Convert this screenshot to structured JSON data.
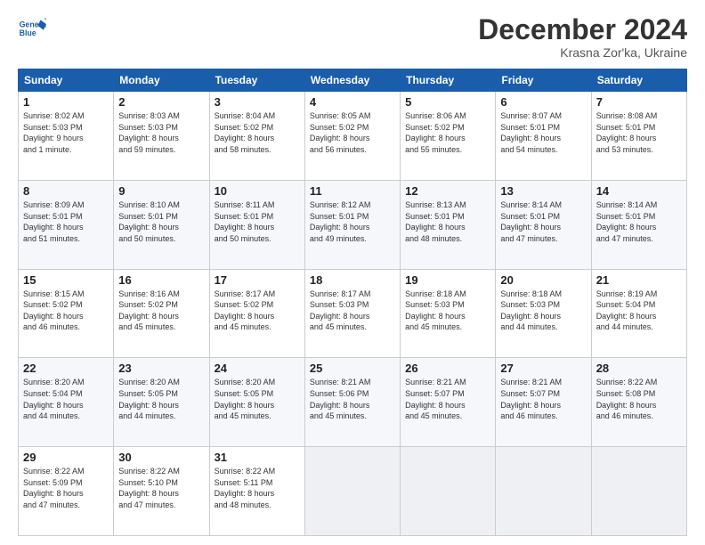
{
  "logo": {
    "line1": "General",
    "line2": "Blue"
  },
  "header": {
    "month_title": "December 2024",
    "subtitle": "Krasna Zor'ka, Ukraine"
  },
  "weekdays": [
    "Sunday",
    "Monday",
    "Tuesday",
    "Wednesday",
    "Thursday",
    "Friday",
    "Saturday"
  ],
  "weeks": [
    [
      {
        "day": "1",
        "info": "Sunrise: 8:02 AM\nSunset: 5:03 PM\nDaylight: 9 hours\nand 1 minute."
      },
      {
        "day": "2",
        "info": "Sunrise: 8:03 AM\nSunset: 5:03 PM\nDaylight: 8 hours\nand 59 minutes."
      },
      {
        "day": "3",
        "info": "Sunrise: 8:04 AM\nSunset: 5:02 PM\nDaylight: 8 hours\nand 58 minutes."
      },
      {
        "day": "4",
        "info": "Sunrise: 8:05 AM\nSunset: 5:02 PM\nDaylight: 8 hours\nand 56 minutes."
      },
      {
        "day": "5",
        "info": "Sunrise: 8:06 AM\nSunset: 5:02 PM\nDaylight: 8 hours\nand 55 minutes."
      },
      {
        "day": "6",
        "info": "Sunrise: 8:07 AM\nSunset: 5:01 PM\nDaylight: 8 hours\nand 54 minutes."
      },
      {
        "day": "7",
        "info": "Sunrise: 8:08 AM\nSunset: 5:01 PM\nDaylight: 8 hours\nand 53 minutes."
      }
    ],
    [
      {
        "day": "8",
        "info": "Sunrise: 8:09 AM\nSunset: 5:01 PM\nDaylight: 8 hours\nand 51 minutes."
      },
      {
        "day": "9",
        "info": "Sunrise: 8:10 AM\nSunset: 5:01 PM\nDaylight: 8 hours\nand 50 minutes."
      },
      {
        "day": "10",
        "info": "Sunrise: 8:11 AM\nSunset: 5:01 PM\nDaylight: 8 hours\nand 50 minutes."
      },
      {
        "day": "11",
        "info": "Sunrise: 8:12 AM\nSunset: 5:01 PM\nDaylight: 8 hours\nand 49 minutes."
      },
      {
        "day": "12",
        "info": "Sunrise: 8:13 AM\nSunset: 5:01 PM\nDaylight: 8 hours\nand 48 minutes."
      },
      {
        "day": "13",
        "info": "Sunrise: 8:14 AM\nSunset: 5:01 PM\nDaylight: 8 hours\nand 47 minutes."
      },
      {
        "day": "14",
        "info": "Sunrise: 8:14 AM\nSunset: 5:01 PM\nDaylight: 8 hours\nand 47 minutes."
      }
    ],
    [
      {
        "day": "15",
        "info": "Sunrise: 8:15 AM\nSunset: 5:02 PM\nDaylight: 8 hours\nand 46 minutes."
      },
      {
        "day": "16",
        "info": "Sunrise: 8:16 AM\nSunset: 5:02 PM\nDaylight: 8 hours\nand 45 minutes."
      },
      {
        "day": "17",
        "info": "Sunrise: 8:17 AM\nSunset: 5:02 PM\nDaylight: 8 hours\nand 45 minutes."
      },
      {
        "day": "18",
        "info": "Sunrise: 8:17 AM\nSunset: 5:03 PM\nDaylight: 8 hours\nand 45 minutes."
      },
      {
        "day": "19",
        "info": "Sunrise: 8:18 AM\nSunset: 5:03 PM\nDaylight: 8 hours\nand 45 minutes."
      },
      {
        "day": "20",
        "info": "Sunrise: 8:18 AM\nSunset: 5:03 PM\nDaylight: 8 hours\nand 44 minutes."
      },
      {
        "day": "21",
        "info": "Sunrise: 8:19 AM\nSunset: 5:04 PM\nDaylight: 8 hours\nand 44 minutes."
      }
    ],
    [
      {
        "day": "22",
        "info": "Sunrise: 8:20 AM\nSunset: 5:04 PM\nDaylight: 8 hours\nand 44 minutes."
      },
      {
        "day": "23",
        "info": "Sunrise: 8:20 AM\nSunset: 5:05 PM\nDaylight: 8 hours\nand 44 minutes."
      },
      {
        "day": "24",
        "info": "Sunrise: 8:20 AM\nSunset: 5:05 PM\nDaylight: 8 hours\nand 45 minutes."
      },
      {
        "day": "25",
        "info": "Sunrise: 8:21 AM\nSunset: 5:06 PM\nDaylight: 8 hours\nand 45 minutes."
      },
      {
        "day": "26",
        "info": "Sunrise: 8:21 AM\nSunset: 5:07 PM\nDaylight: 8 hours\nand 45 minutes."
      },
      {
        "day": "27",
        "info": "Sunrise: 8:21 AM\nSunset: 5:07 PM\nDaylight: 8 hours\nand 46 minutes."
      },
      {
        "day": "28",
        "info": "Sunrise: 8:22 AM\nSunset: 5:08 PM\nDaylight: 8 hours\nand 46 minutes."
      }
    ],
    [
      {
        "day": "29",
        "info": "Sunrise: 8:22 AM\nSunset: 5:09 PM\nDaylight: 8 hours\nand 47 minutes."
      },
      {
        "day": "30",
        "info": "Sunrise: 8:22 AM\nSunset: 5:10 PM\nDaylight: 8 hours\nand 47 minutes."
      },
      {
        "day": "31",
        "info": "Sunrise: 8:22 AM\nSunset: 5:11 PM\nDaylight: 8 hours\nand 48 minutes."
      },
      null,
      null,
      null,
      null
    ]
  ]
}
